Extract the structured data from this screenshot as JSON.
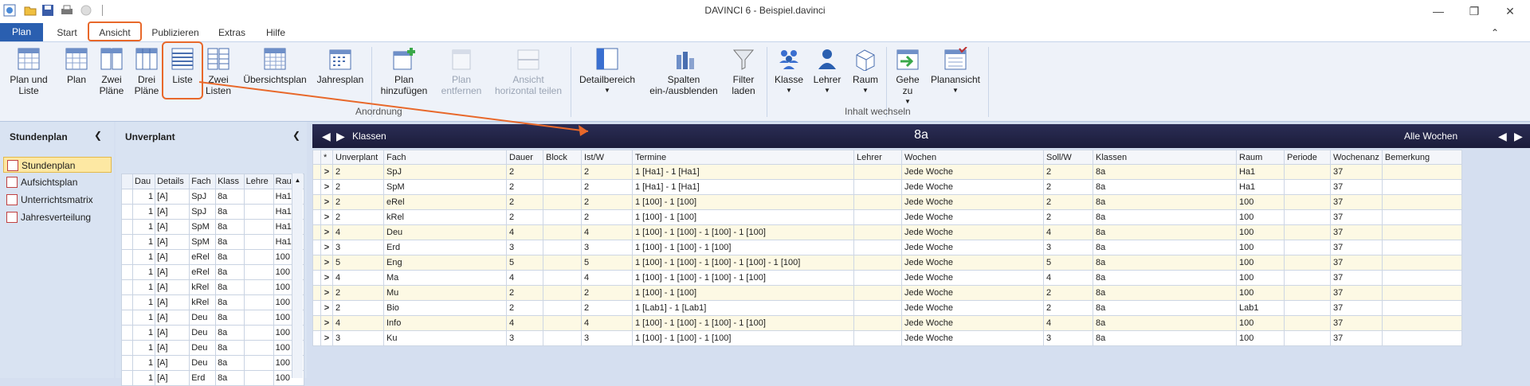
{
  "window": {
    "title": "DAVINCI 6 - Beispiel.davinci"
  },
  "tabs": [
    "Plan",
    "Start",
    "Ansicht",
    "Publizieren",
    "Extras",
    "Hilfe"
  ],
  "ribbon": {
    "buttons": [
      "Plan und Liste",
      "Plan",
      "Zwei Pläne",
      "Drei Pläne",
      "Liste",
      "Zwei Listen",
      "Übersichtsplan",
      "Jahresplan",
      "Plan hinzufügen",
      "Plan entfernen",
      "Ansicht horizontal teilen",
      "Detailbereich",
      "Spalten ein-/ausblenden",
      "Filter laden",
      "Klasse",
      "Lehrer",
      "Raum",
      "Gehe zu",
      "Planansicht"
    ],
    "groups": [
      "Anordnung",
      "Inhalt wechseln"
    ]
  },
  "left_panel": {
    "title": "Stundenplan",
    "items": [
      "Stundenplan",
      "Aufsichtsplan",
      "Unterrichtsmatrix",
      "Jahresverteilung"
    ]
  },
  "unverplant": {
    "title": "Unverplant",
    "columns": [
      "",
      "Dau",
      "Details",
      "Fach",
      "Klass",
      "Lehre",
      "Raum"
    ],
    "rows": [
      [
        "1",
        "[A]",
        "SpJ",
        "8a",
        "",
        "Ha1"
      ],
      [
        "1",
        "[A]",
        "SpJ",
        "8a",
        "",
        "Ha1"
      ],
      [
        "1",
        "[A]",
        "SpM",
        "8a",
        "",
        "Ha1"
      ],
      [
        "1",
        "[A]",
        "SpM",
        "8a",
        "",
        "Ha1"
      ],
      [
        "1",
        "[A]",
        "eRel",
        "8a",
        "",
        "100"
      ],
      [
        "1",
        "[A]",
        "eRel",
        "8a",
        "",
        "100"
      ],
      [
        "1",
        "[A]",
        "kRel",
        "8a",
        "",
        "100"
      ],
      [
        "1",
        "[A]",
        "kRel",
        "8a",
        "",
        "100"
      ],
      [
        "1",
        "[A]",
        "Deu",
        "8a",
        "",
        "100"
      ],
      [
        "1",
        "[A]",
        "Deu",
        "8a",
        "",
        "100"
      ],
      [
        "1",
        "[A]",
        "Deu",
        "8a",
        "",
        "100"
      ],
      [
        "1",
        "[A]",
        "Deu",
        "8a",
        "",
        "100"
      ],
      [
        "1",
        "[A]",
        "Erd",
        "8a",
        "",
        "100"
      ]
    ]
  },
  "main": {
    "header_left": "Klassen",
    "header_center": "8a",
    "header_right": "Alle Wochen",
    "columns": [
      "*",
      "Unverplant",
      "Fach",
      "Dauer",
      "Block",
      "Ist/W",
      "Termine",
      "Lehrer",
      "Wochen",
      "Soll/W",
      "Klassen",
      "Raum",
      "Periode",
      "Wochenanz",
      "Bemerkung"
    ],
    "rows": [
      [
        ">",
        "2",
        "SpJ",
        "2",
        "",
        "2",
        "1 [Ha1] - 1 [Ha1]",
        "",
        "Jede Woche",
        "2",
        "8a",
        "Ha1",
        "",
        "37",
        ""
      ],
      [
        ">",
        "2",
        "SpM",
        "2",
        "",
        "2",
        "1 [Ha1] - 1 [Ha1]",
        "",
        "Jede Woche",
        "2",
        "8a",
        "Ha1",
        "",
        "37",
        ""
      ],
      [
        ">",
        "2",
        "eRel",
        "2",
        "",
        "2",
        "1 [100] - 1 [100]",
        "",
        "Jede Woche",
        "2",
        "8a",
        "100",
        "",
        "37",
        ""
      ],
      [
        ">",
        "2",
        "kRel",
        "2",
        "",
        "2",
        "1 [100] - 1 [100]",
        "",
        "Jede Woche",
        "2",
        "8a",
        "100",
        "",
        "37",
        ""
      ],
      [
        ">",
        "4",
        "Deu",
        "4",
        "",
        "4",
        "1 [100] - 1 [100] - 1 [100] - 1 [100]",
        "",
        "Jede Woche",
        "4",
        "8a",
        "100",
        "",
        "37",
        ""
      ],
      [
        ">",
        "3",
        "Erd",
        "3",
        "",
        "3",
        "1 [100] - 1 [100] - 1 [100]",
        "",
        "Jede Woche",
        "3",
        "8a",
        "100",
        "",
        "37",
        ""
      ],
      [
        ">",
        "5",
        "Eng",
        "5",
        "",
        "5",
        "1 [100] - 1 [100] - 1 [100] - 1 [100] - 1 [100]",
        "",
        "Jede Woche",
        "5",
        "8a",
        "100",
        "",
        "37",
        ""
      ],
      [
        ">",
        "4",
        "Ma",
        "4",
        "",
        "4",
        "1 [100] - 1 [100] - 1 [100] - 1 [100]",
        "",
        "Jede Woche",
        "4",
        "8a",
        "100",
        "",
        "37",
        ""
      ],
      [
        ">",
        "2",
        "Mu",
        "2",
        "",
        "2",
        "1 [100] - 1 [100]",
        "",
        "Jede Woche",
        "2",
        "8a",
        "100",
        "",
        "37",
        ""
      ],
      [
        ">",
        "2",
        "Bio",
        "2",
        "",
        "2",
        "1 [Lab1] - 1 [Lab1]",
        "",
        "Jede Woche",
        "2",
        "8a",
        "Lab1",
        "",
        "37",
        ""
      ],
      [
        ">",
        "4",
        "Info",
        "4",
        "",
        "4",
        "1 [100] - 1 [100] - 1 [100] - 1 [100]",
        "",
        "Jede Woche",
        "4",
        "8a",
        "100",
        "",
        "37",
        ""
      ],
      [
        ">",
        "3",
        "Ku",
        "3",
        "",
        "3",
        "1 [100] - 1 [100] - 1 [100]",
        "",
        "Jede Woche",
        "3",
        "8a",
        "100",
        "",
        "37",
        ""
      ]
    ]
  },
  "colors": {
    "accent": "#2a5fb0",
    "highlight": "#e8682a",
    "header_dark": "#1b1c3a",
    "row_alt": "#fdf9e4"
  }
}
